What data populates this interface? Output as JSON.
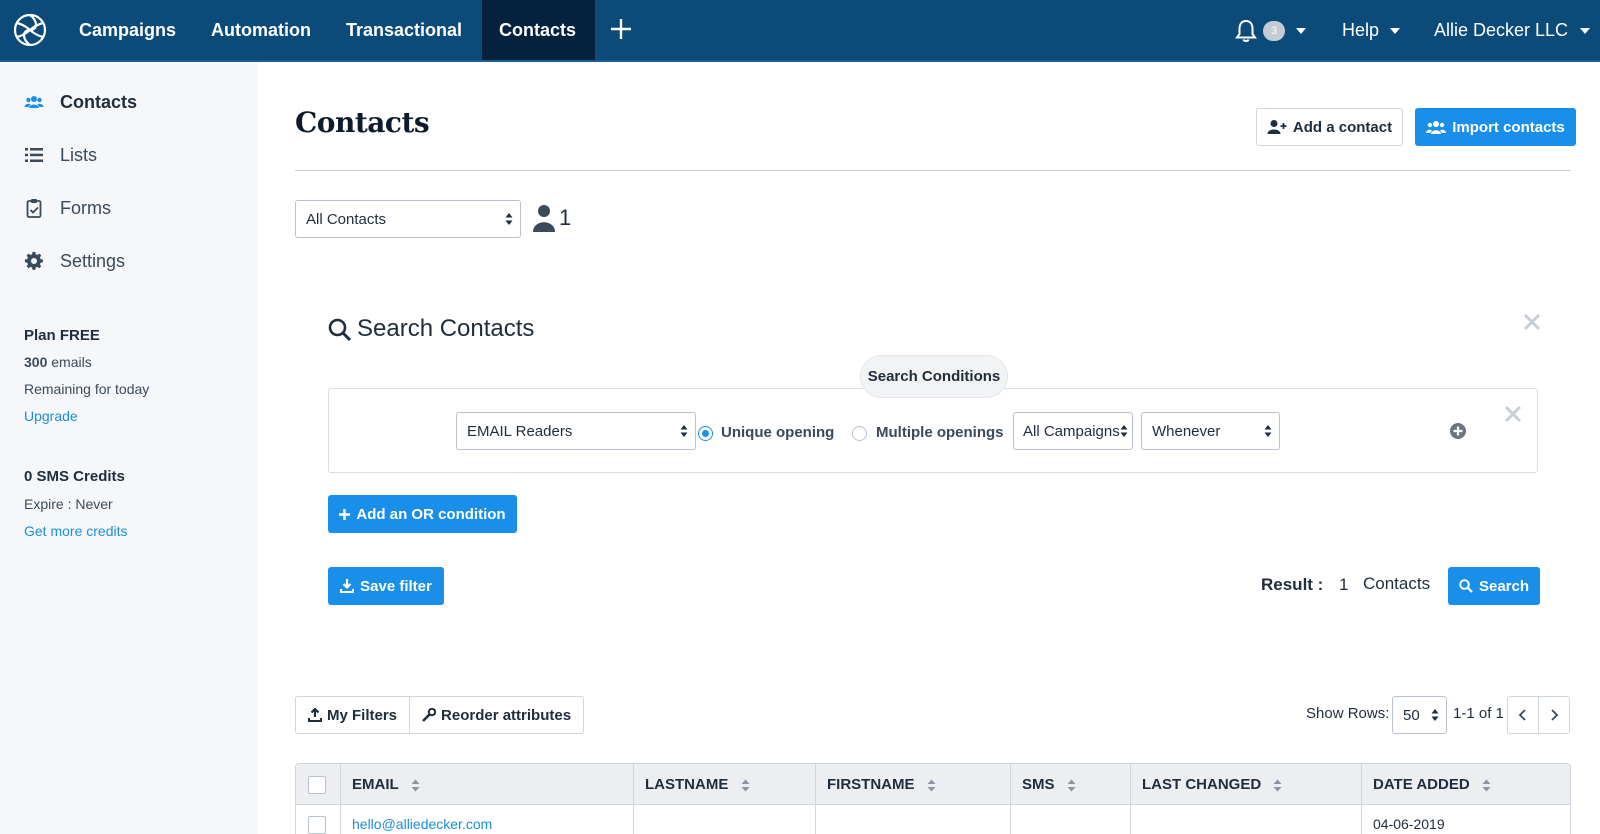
{
  "topnav": {
    "items": [
      "Campaigns",
      "Automation",
      "Transactional",
      "Contacts"
    ],
    "active": "Contacts",
    "notifications_count": "3",
    "help_label": "Help",
    "account_label": "Allie Decker LLC"
  },
  "sidebar": {
    "items": [
      {
        "label": "Contacts",
        "icon": "users-icon"
      },
      {
        "label": "Lists",
        "icon": "list-icon"
      },
      {
        "label": "Forms",
        "icon": "clipboard-icon"
      },
      {
        "label": "Settings",
        "icon": "gear-icon"
      }
    ],
    "plan": {
      "title": "Plan FREE",
      "emails_count": "300",
      "emails_unit": "emails",
      "remaining": "Remaining for today",
      "upgrade": "Upgrade"
    },
    "sms": {
      "title": "0 SMS Credits",
      "expire": "Expire : Never",
      "more": "Get more credits"
    }
  },
  "header": {
    "title": "Contacts",
    "add_contact": "Add a contact",
    "import_contacts": "Import contacts"
  },
  "list_filter": {
    "selected": "All Contacts",
    "count": "1"
  },
  "search": {
    "title": "Search Contacts",
    "conditions_label": "Search Conditions",
    "condition": {
      "type": "EMAIL Readers",
      "radio_unique": "Unique opening",
      "radio_multiple": "Multiple openings",
      "radio_selected": "unique",
      "campaign": "All Campaigns",
      "when": "Whenever"
    },
    "add_or": "Add an OR condition",
    "save_filter": "Save filter",
    "result_label": "Result :",
    "result_count": "1",
    "result_unit": "Contacts",
    "search_button": "Search"
  },
  "toolbar": {
    "my_filters": "My Filters",
    "reorder": "Reorder attributes",
    "show_rows_label": "Show Rows:",
    "show_rows_value": "50",
    "range": "1-1 of 1"
  },
  "table": {
    "columns": [
      "EMAIL",
      "LASTNAME",
      "FIRSTNAME",
      "SMS",
      "LAST CHANGED",
      "DATE ADDED"
    ],
    "rows": [
      {
        "email": "hello@alliedecker.com",
        "lastname": "",
        "firstname": "",
        "sms": "",
        "last_changed": "",
        "date_added": "04-06-2019"
      }
    ]
  },
  "colors": {
    "nav_bg": "#0b4a79",
    "nav_active": "#04223b",
    "primary": "#1a8fea",
    "link": "#1a8fd8",
    "sidebar_bg": "#f5f7fa"
  }
}
